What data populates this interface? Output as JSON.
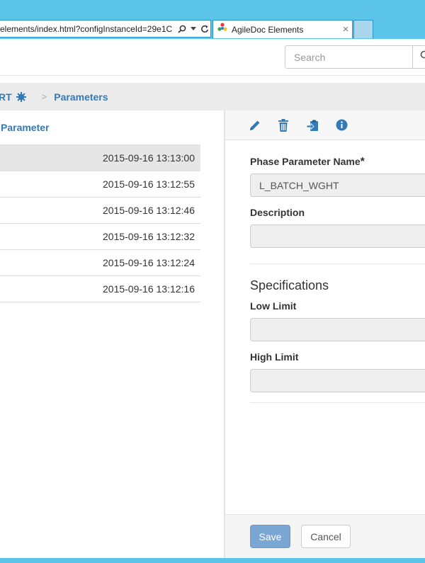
{
  "browser": {
    "address": "elements/index.html?configInstanceId=29e1C",
    "tab_title": "AgileDoc Elements",
    "tab_close": "×",
    "search_icon": "search-icon",
    "refresh_icon": "refresh-icon"
  },
  "topbar": {
    "search_placeholder": "Search"
  },
  "breadcrumb": {
    "prev_label": "RT",
    "separator": ">",
    "current_label": "Parameters"
  },
  "list": {
    "header": "Parameter",
    "items": [
      {
        "timestamp": "2015-09-16 13:13:00",
        "selected": true
      },
      {
        "timestamp": "2015-09-16 13:12:55",
        "selected": false
      },
      {
        "timestamp": "2015-09-16 13:12:46",
        "selected": false
      },
      {
        "timestamp": "2015-09-16 13:12:32",
        "selected": false
      },
      {
        "timestamp": "2015-09-16 13:12:24",
        "selected": false
      },
      {
        "timestamp": "2015-09-16 13:12:16",
        "selected": false
      }
    ]
  },
  "toolbar": {
    "icons": [
      "pencil-icon",
      "trash-icon",
      "clipboard-icon",
      "info-icon"
    ]
  },
  "form": {
    "name_label": "Phase Parameter Name",
    "required_mark": "*",
    "name_value": "L_BATCH_WGHT",
    "description_label": "Description",
    "description_value": "",
    "specs_title": "Specifications",
    "low_label": "Low Limit",
    "low_value": "",
    "high_label": "High Limit",
    "high_value": ""
  },
  "footer": {
    "save_label": "Save",
    "cancel_label": "Cancel"
  },
  "colors": {
    "accent": "#337ab7",
    "chrome": "#5cc3e9",
    "save_button": "#7aa6d3"
  }
}
